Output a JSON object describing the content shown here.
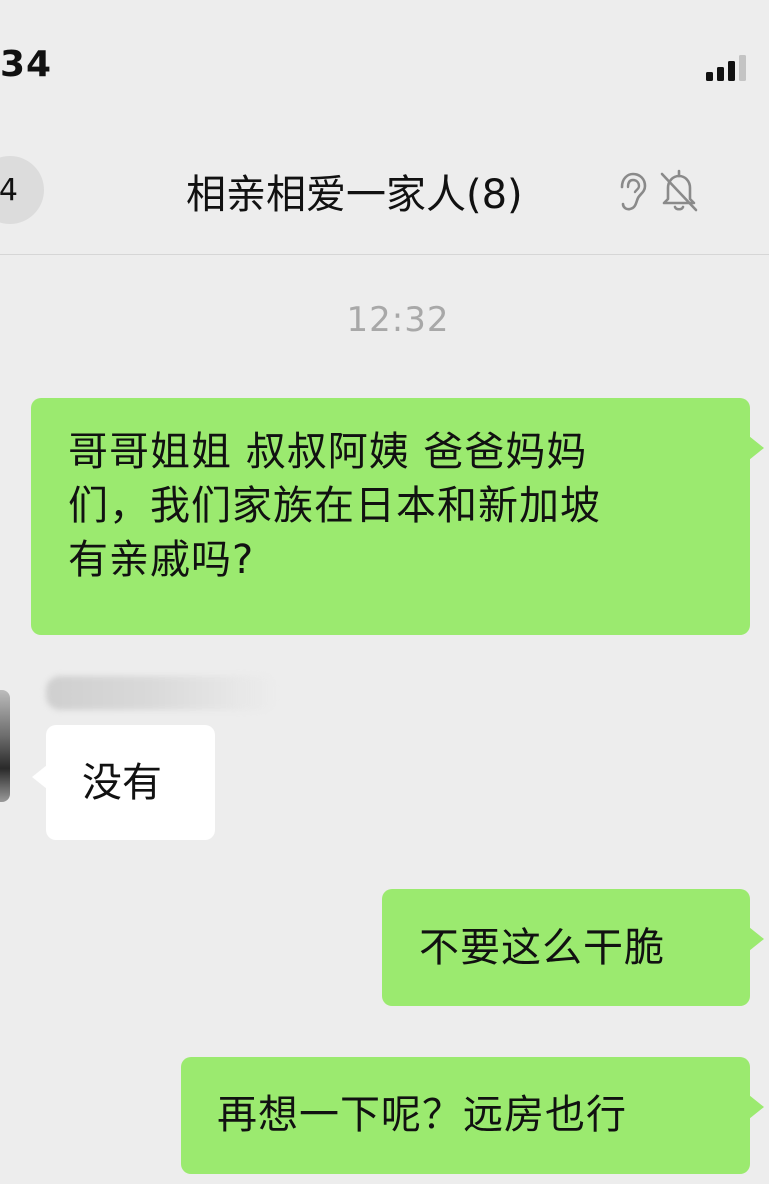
{
  "status_bar": {
    "time": "34"
  },
  "nav": {
    "back_count": "4",
    "title": "相亲相爱一家人(8)"
  },
  "timestamp": "12:32",
  "messages": [
    {
      "side": "right",
      "lines": [
        "哥哥姐姐 叔叔阿姨 爸爸妈妈",
        "们，我们家族在日本和新加坡",
        "有亲戚吗?"
      ]
    },
    {
      "side": "left",
      "text": "没有"
    },
    {
      "side": "right",
      "text": "不要这么干脆"
    },
    {
      "side": "right",
      "text": "再想一下呢？远房也行"
    }
  ],
  "colors": {
    "background": "#ededed",
    "sent_bubble": "#9bea6f",
    "received_bubble": "#ffffff",
    "timestamp_text": "#a8a8a8"
  },
  "icons": {
    "signal": "cellular-signal-icon",
    "ear": "ear-icon",
    "mute": "muted-bell-icon"
  }
}
